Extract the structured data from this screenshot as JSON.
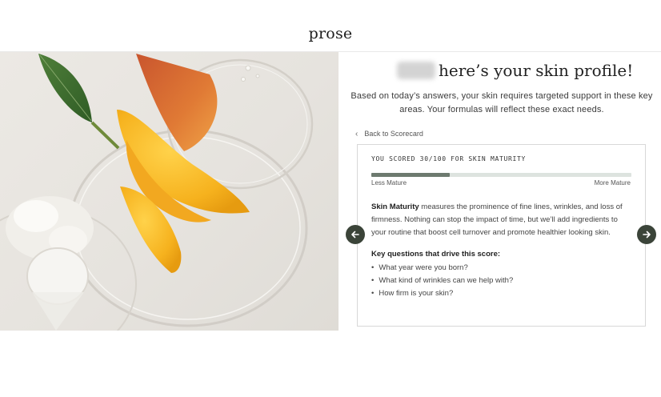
{
  "header": {
    "logo": "prose"
  },
  "hero": {
    "image": "mango-slices-and-glass-dishes-photo"
  },
  "profile": {
    "name_redacted": true,
    "title": "here’s your skin profile!",
    "intro": "Based on today’s answers, your skin requires targeted support in these key areas. Your formulas will reflect these exact needs."
  },
  "nav": {
    "back_label": "Back to Scorecard",
    "prev_icon": "arrow-left-icon",
    "next_icon": "arrow-right-icon"
  },
  "card": {
    "score_label": "YOU SCORED 30/100 FOR SKIN MATURITY",
    "score_value": 30,
    "score_max": 100,
    "scale_low": "Less Mature",
    "scale_high": "More Mature",
    "desc_term": "Skin Maturity",
    "desc_rest": " measures the prominence of fine lines, wrinkles, and loss of firmness. Nothing can stop the impact of time, but we’ll add ingredients to your routine that boost cell turnover and promote healthier looking skin.",
    "questions_title": "Key questions that drive this score:",
    "questions": [
      "What year were you born?",
      "What kind of wrinkles can we help with?",
      "How firm is your skin?"
    ]
  },
  "colors": {
    "accent": "#3b4439",
    "bar_fill": "#6d7a6f",
    "bar_track": "#dde3df"
  }
}
